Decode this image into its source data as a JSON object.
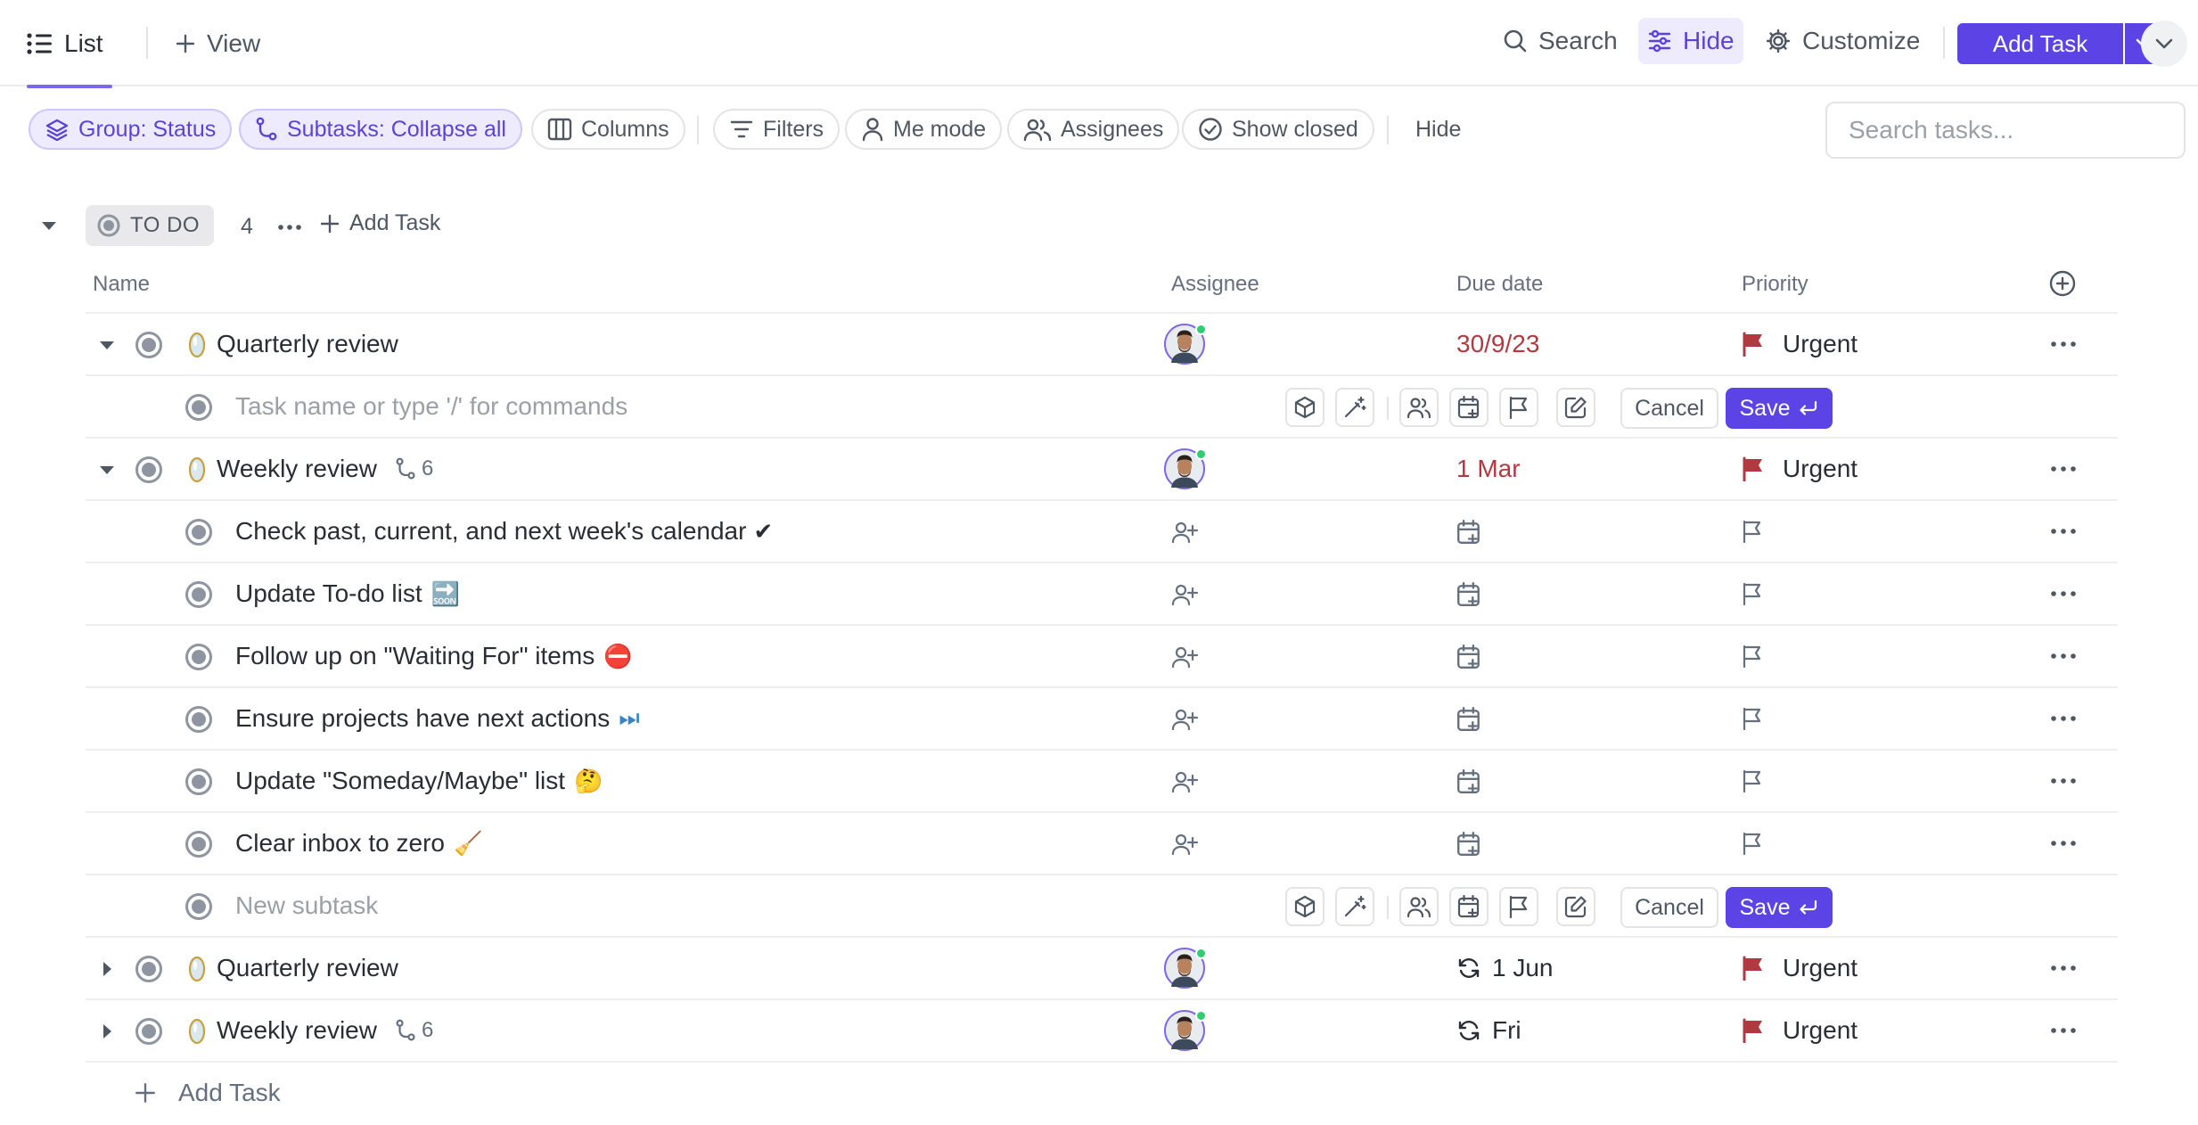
{
  "topbar": {
    "list_tab": "List",
    "view_tab": "View",
    "search": "Search",
    "hide": "Hide",
    "customize": "Customize",
    "add_task": "Add Task"
  },
  "filters": {
    "group": "Group: Status",
    "subtasks": "Subtasks: Collapse all",
    "columns": "Columns",
    "filters": "Filters",
    "me_mode": "Me mode",
    "assignees": "Assignees",
    "show_closed": "Show closed",
    "hide": "Hide",
    "search_placeholder": "Search tasks..."
  },
  "group": {
    "status": "TO DO",
    "count": "4",
    "add_task": "Add Task"
  },
  "columns": {
    "name": "Name",
    "assignee": "Assignee",
    "due": "Due date",
    "priority": "Priority"
  },
  "rows": {
    "r0": {
      "name": "Quarterly review",
      "due": "30/9/23",
      "priority": "Urgent"
    },
    "r1": {
      "placeholder": "Task name or type '/' for commands",
      "cancel": "Cancel",
      "save": "Save"
    },
    "r2": {
      "name": "Weekly review",
      "subtasks": "6",
      "due": "1 Mar",
      "priority": "Urgent"
    },
    "r3": {
      "name": "Check past, current, and next week's calendar",
      "emoji": "✔"
    },
    "r4": {
      "name": "Update To-do list",
      "emoji": "🔜"
    },
    "r5": {
      "name": "Follow up on \"Waiting For\" items",
      "emoji": "⛔"
    },
    "r6": {
      "name": "Ensure projects have next actions",
      "emoji": "⏭"
    },
    "r7": {
      "name": "Update \"Someday/Maybe\" list",
      "emoji": "🤔"
    },
    "r8": {
      "name": "Clear inbox to zero",
      "emoji": "🧹"
    },
    "r9": {
      "placeholder": "New subtask",
      "cancel": "Cancel",
      "save": "Save"
    },
    "r10": {
      "name": "Quarterly review",
      "due": "1 Jun",
      "priority": "Urgent"
    },
    "r11": {
      "name": "Weekly review",
      "subtasks": "6",
      "due": "Fri",
      "priority": "Urgent"
    }
  },
  "footer": {
    "add_task": "Add Task"
  },
  "colors": {
    "accent": "#5b43e6",
    "urgent_flag": "#b13a41",
    "due_red": "#b13a41",
    "online": "#2ecd6f"
  }
}
